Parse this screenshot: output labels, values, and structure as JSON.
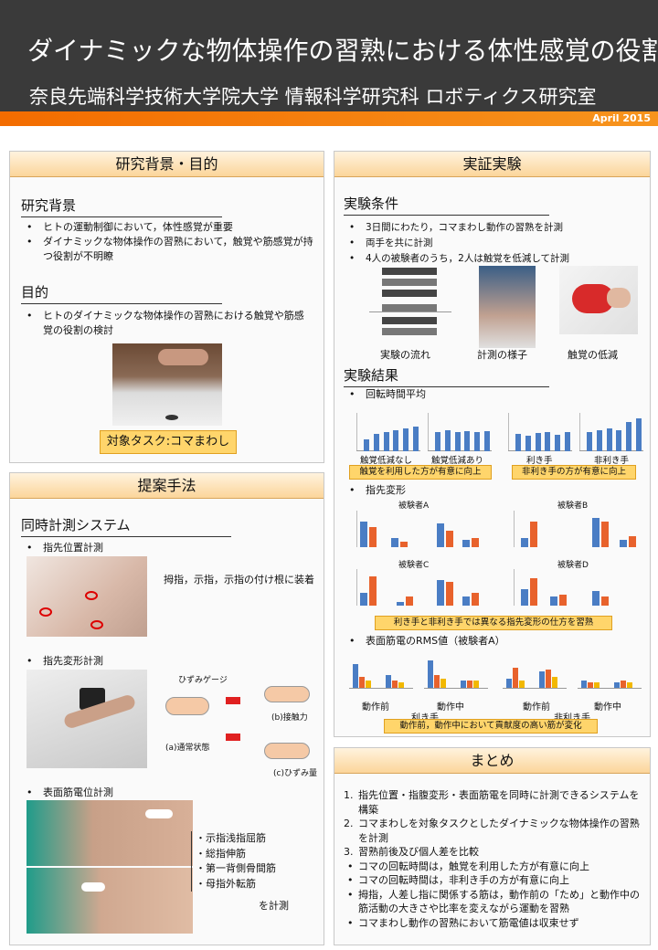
{
  "header": {
    "title": "ダイナミックな物体操作の習熟における体性感覚の役割",
    "affiliation": "奈良先端科学技術大学院大学 情報科学研究科 ロボティクス研究室",
    "date": "April 2015"
  },
  "background": {
    "panel_title": "研究背景・目的",
    "heading1": "研究背景",
    "bullets1": [
      "ヒトの運動制御において，体性感覚が重要",
      "ダイナミックな物体操作の習熟において，触覚や筋感覚が持つ役割が不明瞭"
    ],
    "heading2": "目的",
    "bullets2": [
      "ヒトのダイナミックな物体操作の習熟における触覚や筋感覚の役割の検討"
    ],
    "task_label": "対象タスク:コマまわし"
  },
  "method": {
    "panel_title": "提案手法",
    "heading": "同時計測システム",
    "item1": "指先位置計測",
    "item1_desc": "拇指，示指，示指の付け根に装着",
    "item2": "指先変形計測",
    "diagram_labels": {
      "gauge": "ひずみゲージ",
      "a": "(a)通常状態",
      "b": "(b)接触力",
      "c": "(c)ひずみ量"
    },
    "item3": "表面筋電位計測",
    "muscles": [
      "・示指浅指屈筋",
      "・総指伸筋",
      "・第一背側骨間筋",
      "・母指外転筋"
    ],
    "muscles_suffix": "を計測"
  },
  "experiment": {
    "panel_title": "実証実験",
    "heading1": "実験条件",
    "conditions": [
      "3日間にわたり，コマまわし動作の習熟を計測",
      "両手を共に計測",
      "4人の被験者のうち，2人は触覚を低減して計測"
    ],
    "image_captions": [
      "実験の流れ",
      "計測の様子",
      "触覚の低減"
    ],
    "heading2": "実験結果",
    "result1": "回転時間平均",
    "result1_labels": [
      "触覚低減なし",
      "触覚低減あり",
      "利き手",
      "非利き手"
    ],
    "result1_notes": [
      "触覚を利用した方が有意に向上",
      "非利き手の方が有意に向上"
    ],
    "result2": "指先変形",
    "subjects": [
      "被験者A",
      "被験者B",
      "被験者C",
      "被験者D"
    ],
    "result2_note": "利き手と非利き手では異なる指先変形の仕方を習熟",
    "result3": "表面筋電のRMS値（被験者A）",
    "result3_labels": [
      "動作前",
      "動作中",
      "動作前",
      "動作中"
    ],
    "result3_groups": [
      "利き手",
      "非利き手"
    ],
    "result3_note": "動作前，動作中において貢献度の高い筋が変化"
  },
  "summary": {
    "panel_title": "まとめ",
    "items": [
      {
        "marker": "1.",
        "text": "指先位置・指腹変形・表面筋電を同時に計測できるシステムを構築"
      },
      {
        "marker": "2.",
        "text": "コマまわしを対象タスクとしたダイナミックな物体操作の習熟を計測"
      },
      {
        "marker": "3.",
        "text": "習熟前後及び個人差を比較"
      },
      {
        "marker": "•",
        "text": "コマの回転時間は，触覚を利用した方が有意に向上"
      },
      {
        "marker": "•",
        "text": "コマの回転時間は，非利き手の方が有意に向上"
      },
      {
        "marker": "•",
        "text": "拇指，人差し指に関係する筋は，動作前の「ため」と動作中の筋活動の大きさや比率を変えながら運動を習熟"
      },
      {
        "marker": "•",
        "text": "コマまわし動作の習熟において筋電値は収束せず"
      }
    ]
  },
  "colors": {
    "header_bg": "#3a3a3a",
    "accent_orange": "#f36c00",
    "bar_blue": "#4a7dc4",
    "bar_orange": "#e8622c",
    "bar_yellow": "#f2b800"
  },
  "chart_data": [
    {
      "type": "bar",
      "series": [
        {
          "values": [
            0.3,
            0.45,
            0.5,
            0.55,
            0.6,
            0.65
          ]
        }
      ]
    },
    {
      "type": "bar",
      "series": [
        {
          "values": [
            0.5,
            0.55,
            0.5,
            0.52,
            0.5,
            0.53
          ]
        }
      ]
    },
    {
      "type": "bar",
      "series": [
        {
          "values": [
            0.45,
            0.4,
            0.48,
            0.5,
            0.42,
            0.5
          ]
        }
      ]
    },
    {
      "type": "bar",
      "series": [
        {
          "values": [
            0.5,
            0.55,
            0.6,
            0.55,
            0.75,
            0.85
          ]
        }
      ]
    }
  ]
}
